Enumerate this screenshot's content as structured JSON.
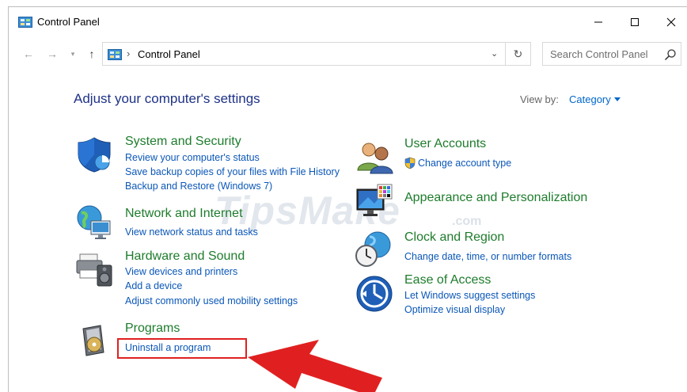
{
  "window": {
    "title": "Control Panel",
    "controls": {
      "minimize": "—",
      "maximize": "☐",
      "close": "✕"
    }
  },
  "navbar": {
    "back_glyph": "←",
    "forward_glyph": "→",
    "recent_glyph": "▾",
    "up_glyph": "↑",
    "separator": "›",
    "address": "Control Panel",
    "dropdown_glyph": "⌄",
    "refresh_glyph": "↻",
    "search_placeholder": "Search Control Panel"
  },
  "main": {
    "heading": "Adjust your computer's settings",
    "view_by_label": "View by:",
    "view_by_value": "Category"
  },
  "categories": {
    "system_security": {
      "title": "System and Security",
      "links": [
        "Review your computer's status",
        "Save backup copies of your files with File History",
        "Backup and Restore (Windows 7)"
      ]
    },
    "network": {
      "title": "Network and Internet",
      "links": [
        "View network status and tasks"
      ]
    },
    "hardware": {
      "title": "Hardware and Sound",
      "links": [
        "View devices and printers",
        "Add a device",
        "Adjust commonly used mobility settings"
      ]
    },
    "programs": {
      "title": "Programs",
      "links": [
        "Uninstall a program"
      ]
    },
    "user_accounts": {
      "title": "User Accounts",
      "links": [
        "Change account type"
      ]
    },
    "appearance": {
      "title": "Appearance and Personalization",
      "links": []
    },
    "clock": {
      "title": "Clock and Region",
      "links": [
        "Change date, time, or number formats"
      ]
    },
    "ease": {
      "title": "Ease of Access",
      "links": [
        "Let Windows suggest settings",
        "Optimize visual display"
      ]
    }
  },
  "watermark": {
    "main": "TipsMake",
    "suffix": ".com"
  },
  "colors": {
    "heading": "#1e3287",
    "category_title": "#1e7c2c",
    "link": "#0b57b8",
    "annotation": "#e02020"
  }
}
